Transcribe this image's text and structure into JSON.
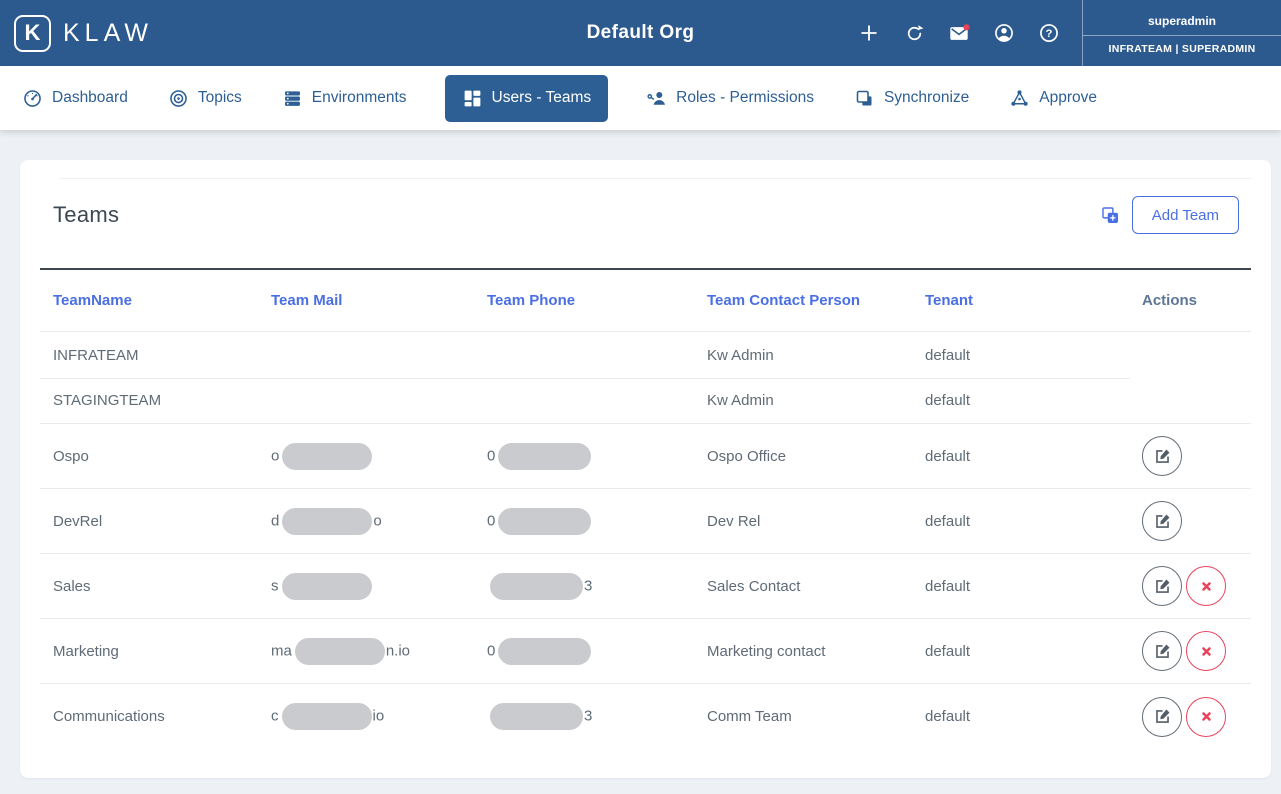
{
  "header": {
    "brand": "KLAW",
    "org_title": "Default Org",
    "user": {
      "name": "superadmin",
      "team_role": "INFRATEAM | SUPERADMIN"
    },
    "icons": [
      "plus-icon",
      "refresh-icon",
      "mail-icon-with-badge",
      "account-icon",
      "help-icon"
    ]
  },
  "nav": {
    "tabs": [
      {
        "label": "Dashboard",
        "icon": "dashboard-gauge-icon",
        "active": false
      },
      {
        "label": "Topics",
        "icon": "topics-target-icon",
        "active": false
      },
      {
        "label": "Environments",
        "icon": "environments-server-icon",
        "active": false
      },
      {
        "label": "Users - Teams",
        "icon": "users-teams-grid-icon",
        "active": true
      },
      {
        "label": "Roles - Permissions",
        "icon": "roles-permissions-key-user-icon",
        "active": false
      },
      {
        "label": "Synchronize",
        "icon": "synchronize-copy-icon",
        "active": false
      },
      {
        "label": "Approve",
        "icon": "approve-network-icon",
        "active": false
      }
    ]
  },
  "teams": {
    "title": "Teams",
    "add_button": "Add Team",
    "columns": [
      "TeamName",
      "Team Mail",
      "Team Phone",
      "Team Contact Person",
      "Tenant",
      "Actions"
    ],
    "rows": [
      {
        "name": "INFRATEAM",
        "mail": {
          "prefix": "",
          "redacted": false,
          "suffix": ""
        },
        "phone": {
          "prefix": "",
          "redacted": false,
          "suffix": ""
        },
        "contact": "Kw Admin",
        "tenant": "default"
      },
      {
        "name": "STAGINGTEAM",
        "mail": {
          "prefix": "",
          "redacted": false,
          "suffix": ""
        },
        "phone": {
          "prefix": "",
          "redacted": false,
          "suffix": ""
        },
        "contact": "Kw Admin",
        "tenant": "default"
      },
      {
        "name": "Ospo",
        "mail": {
          "prefix": "o",
          "redacted": true,
          "suffix": ""
        },
        "phone": {
          "prefix": "0",
          "redacted": true,
          "suffix": ""
        },
        "contact": "Ospo Office",
        "tenant": "default"
      },
      {
        "name": "DevRel",
        "mail": {
          "prefix": "d",
          "redacted": true,
          "suffix": "o"
        },
        "phone": {
          "prefix": "0",
          "redacted": true,
          "suffix": ""
        },
        "contact": "Dev Rel",
        "tenant": "default"
      },
      {
        "name": "Sales",
        "mail": {
          "prefix": "s",
          "redacted": true,
          "suffix": ""
        },
        "phone": {
          "prefix": "",
          "redacted": true,
          "suffix": "3"
        },
        "contact": "Sales Contact",
        "tenant": "default"
      },
      {
        "name": "Marketing",
        "mail": {
          "prefix": "ma",
          "redacted": true,
          "suffix": "n.io"
        },
        "phone": {
          "prefix": "0",
          "redacted": true,
          "suffix": ""
        },
        "contact": "Marketing contact",
        "tenant": "default"
      },
      {
        "name": "Communications",
        "mail": {
          "prefix": "c",
          "redacted": true,
          "suffix": "io"
        },
        "phone": {
          "prefix": "",
          "redacted": true,
          "suffix": "3"
        },
        "contact": "Comm Team",
        "tenant": "default"
      }
    ]
  },
  "colors": {
    "header_blue": "#2d5a8e",
    "nav_blue": "#2d5f94",
    "link_blue": "#4a6fe3",
    "danger_red": "#e8435a",
    "redaction_gray": "#c9cbce",
    "text_gray": "#5f6b76",
    "page_bg": "#edf0f4"
  }
}
